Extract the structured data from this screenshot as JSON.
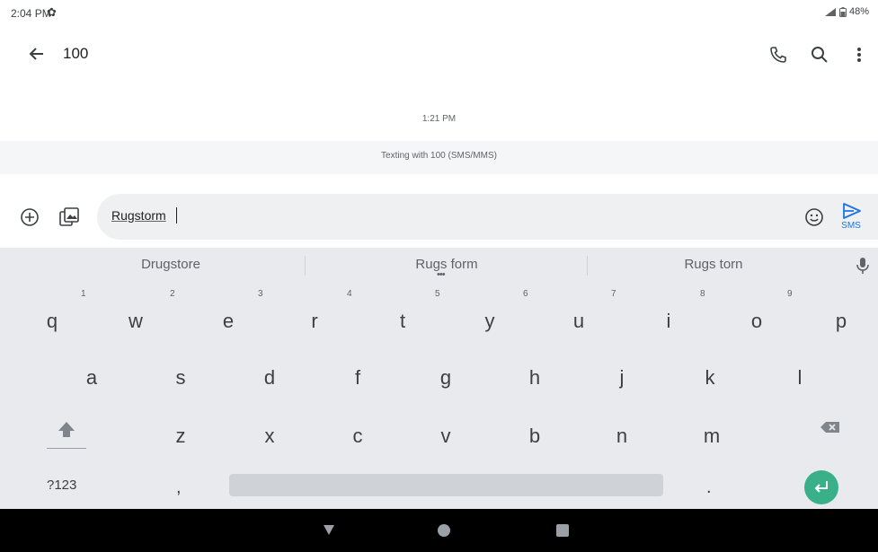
{
  "status_bar": {
    "time": "2:04 PM",
    "battery": "48%",
    "icons": [
      "settings-gear-icon",
      "signal-icon",
      "battery-icon"
    ]
  },
  "app_bar": {
    "title": "100",
    "icons": [
      "back-arrow-icon",
      "phone-icon",
      "search-icon",
      "more-vert-icon"
    ]
  },
  "conversation": {
    "timestamp": "1:21 PM",
    "banner": "Texting with 100 (SMS/MMS)"
  },
  "compose": {
    "text": "Rugstorm",
    "send_label": "SMS",
    "accent_color": "#1a73e8",
    "icons": [
      "add-circle-icon",
      "gallery-icon",
      "emoji-icon",
      "send-icon"
    ]
  },
  "keyboard": {
    "suggestions": [
      "Drugstore",
      "Rugs form",
      "Rugs torn"
    ],
    "row1": [
      "q",
      "w",
      "e",
      "r",
      "t",
      "y",
      "u",
      "i",
      "o",
      "p"
    ],
    "row1_hints": [
      "1",
      "2",
      "3",
      "4",
      "5",
      "6",
      "7",
      "8",
      "9"
    ],
    "row2": [
      "a",
      "s",
      "d",
      "f",
      "g",
      "h",
      "j",
      "k",
      "l"
    ],
    "row3": [
      "z",
      "x",
      "c",
      "v",
      "b",
      "n",
      "m"
    ],
    "num_key": "?123",
    "comma": ",",
    "period": ".",
    "enter_color": "#39b088"
  }
}
